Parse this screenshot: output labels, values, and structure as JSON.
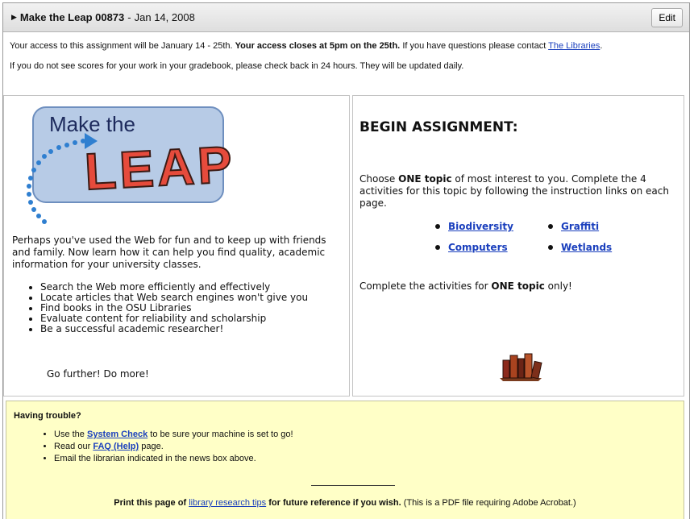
{
  "header": {
    "title": "Make the Leap 00873",
    "date_sep": "-",
    "date": "Jan 14, 2008",
    "edit_label": "Edit"
  },
  "notice1": {
    "pre": "Your access to this assignment will be January 14 - 25th.",
    "bold": "Your access closes at 5pm on the 25th.",
    "post": "If you have questions please contact",
    "link": "The Libraries",
    "end": "."
  },
  "notice2": "If you do not see scores for your work in your gradebook, please check back in 24 hours. They will be updated daily.",
  "logo": {
    "line1": "Make the",
    "line2": "LEAP"
  },
  "left": {
    "intro": "Perhaps you've used the Web for fun and to keep up with friends and family. Now learn how it can help you find quality, academic information for your university classes.",
    "bullets": [
      "Search the Web more efficiently and effectively",
      "Locate articles that Web search engines won't give you",
      "Find books in the OSU Libraries",
      "Evaluate content for reliability and scholarship",
      "Be a successful academic researcher!"
    ],
    "go_further": "Go further! Do more!"
  },
  "right": {
    "heading": "BEGIN ASSIGNMENT:",
    "choose_pre": "Choose",
    "choose_bold": "ONE topic",
    "choose_post": "of most interest to you. Complete the 4 activities for this topic by following the instruction links on each page.",
    "topics": [
      "Biodiversity",
      "Graffiti",
      "Computers",
      "Wetlands"
    ],
    "complete_pre": "Complete the activities for",
    "complete_bold": "ONE topic",
    "complete_post": "only!"
  },
  "trouble": {
    "heading": "Having trouble?",
    "item1_pre": "Use the",
    "item1_link": "System Check",
    "item1_post": "to be sure your machine is set to go!",
    "item2_pre": "Read our",
    "item2_link": "FAQ (Help)",
    "item2_post": "page.",
    "item3": "Email the librarian indicated in the news box above.",
    "print_pre": "Print this page of",
    "print_link": "library research tips",
    "print_mid": "for future reference if you wish.",
    "print_note": "(This is a PDF file requiring Adobe Acrobat.)"
  },
  "colors": {
    "logo_box": "#b7cbe6",
    "leap_red": "#e64b3c",
    "trouble_bg": "#ffffc7",
    "link": "#1a3fbd"
  }
}
